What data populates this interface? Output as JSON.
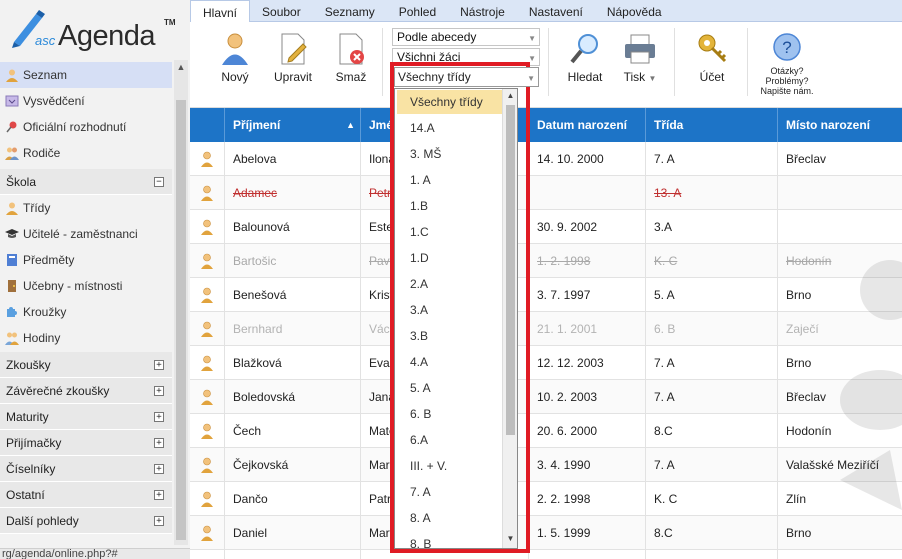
{
  "app": {
    "name": "Agenda",
    "prefix": "asc",
    "trademark": "TM"
  },
  "menu_tabs": [
    "Hlavní",
    "Soubor",
    "Seznamy",
    "Pohled",
    "Nástroje",
    "Nastavení",
    "Nápověda"
  ],
  "toolbar": {
    "new_label": "Nový",
    "edit_label": "Upravit",
    "delete_label": "Smaž",
    "sort_select": "Podle abecedy",
    "students_select": "Všichni žáci",
    "class_select": "Všechny třídy",
    "search_label": "Hledat",
    "print_label": "Tisk",
    "account_label": "Účet",
    "help_line1": "Otázky?",
    "help_line2": "Problémy?",
    "help_line3": "Napište nám."
  },
  "sidebar": {
    "top_items": [
      {
        "label": "Seznam",
        "icon": "students-icon",
        "active": true
      },
      {
        "label": "Vysvědčení",
        "icon": "report-card-icon"
      },
      {
        "label": "Oficiální rozhodnutí",
        "icon": "pin-icon"
      },
      {
        "label": "Rodiče",
        "icon": "parents-icon"
      }
    ],
    "school_section": "Škola",
    "school_items": [
      {
        "label": "Třídy",
        "icon": "classes-icon"
      },
      {
        "label": "Učitelé - zaměstnanci",
        "icon": "graduation-cap-icon"
      },
      {
        "label": "Předměty",
        "icon": "book-icon"
      },
      {
        "label": "Učebny - místnosti",
        "icon": "door-icon"
      },
      {
        "label": "Kroužky",
        "icon": "puzzle-icon"
      },
      {
        "label": "Hodiny",
        "icon": "group-icon"
      }
    ],
    "sections": [
      "Zkoušky",
      "Závěrečné zkoušky",
      "Maturity",
      "Přijímačky",
      "Číselníky",
      "Ostatní",
      "Další pohledy"
    ],
    "collapse_symbol": "−",
    "expand_symbol": "+"
  },
  "status_url": "rg/agenda/online.php?#",
  "grid": {
    "columns": [
      "Příjmení",
      "Jméno",
      "Datum narození",
      "Třída",
      "Místo narození"
    ],
    "sort_indicator": "▲",
    "rows": [
      {
        "surname": "Abelova",
        "first": "Ilona",
        "dob": "14. 10. 2000",
        "cls": "7. A",
        "place": "Břeclav",
        "state": "normal"
      },
      {
        "surname": "Adamec",
        "first": "Petr",
        "dob": "",
        "cls": "13. A",
        "place": "",
        "state": "deleted"
      },
      {
        "surname": "Balounová",
        "first": "Ester",
        "dob": "30. 9. 2002",
        "cls": "3.A",
        "place": "",
        "state": "normal"
      },
      {
        "surname": "Bartošic",
        "first": "Pavel",
        "dob": "1. 2. 1998",
        "cls": "K. C",
        "place": "Hodonín",
        "state": "inactive"
      },
      {
        "surname": "Benešová",
        "first": "Kristýna",
        "dob": "3. 7. 1997",
        "cls": "5. A",
        "place": "Brno",
        "state": "normal"
      },
      {
        "surname": "Bernhard",
        "first": "Václav",
        "dob": "21. 1. 2001",
        "cls": "6. B",
        "place": "Zaječí",
        "state": "dim"
      },
      {
        "surname": "Blažková",
        "first": "Eva",
        "dob": "12. 12. 2003",
        "cls": "7. A",
        "place": "Brno",
        "state": "normal"
      },
      {
        "surname": "Boledovská",
        "first": "Jana",
        "dob": "10. 2. 2003",
        "cls": "7. A",
        "place": "Břeclav",
        "state": "normal"
      },
      {
        "surname": "Čech",
        "first": "Matěj",
        "dob": "20. 6. 2000",
        "cls": "8.C",
        "place": "Hodonín",
        "state": "normal"
      },
      {
        "surname": "Čejkovská",
        "first": "Marie",
        "dob": "3. 4. 1990",
        "cls": "7. A",
        "place": "Valašské Meziříčí",
        "state": "normal"
      },
      {
        "surname": "Dančo",
        "first": "Patrik",
        "dob": "2. 2. 1998",
        "cls": "K. C",
        "place": "Zlín",
        "state": "normal"
      },
      {
        "surname": "Daniel",
        "first": "Martin",
        "dob": "1. 5. 1999",
        "cls": "8.C",
        "place": "Brno",
        "state": "normal"
      },
      {
        "surname": "",
        "first": "",
        "dob": "",
        "cls": "",
        "place": "",
        "state": "normal"
      }
    ]
  },
  "class_dropdown": {
    "options": [
      "Všechny třídy",
      "14.A",
      "3. MŠ",
      "1. A",
      "1.B",
      "1.C",
      "1.D",
      "2.A",
      "3.A",
      "3.B",
      "4.A",
      "5. A",
      "6. B",
      "6.A",
      "III. + V.",
      "7. A",
      "8. A",
      "8. B"
    ],
    "selected_index": 0,
    "highlight_color": "#e01b24"
  },
  "colors": {
    "grid_header": "#1d74c7",
    "selected_option": "#f9e3a4",
    "deleted_text": "#c03030"
  }
}
